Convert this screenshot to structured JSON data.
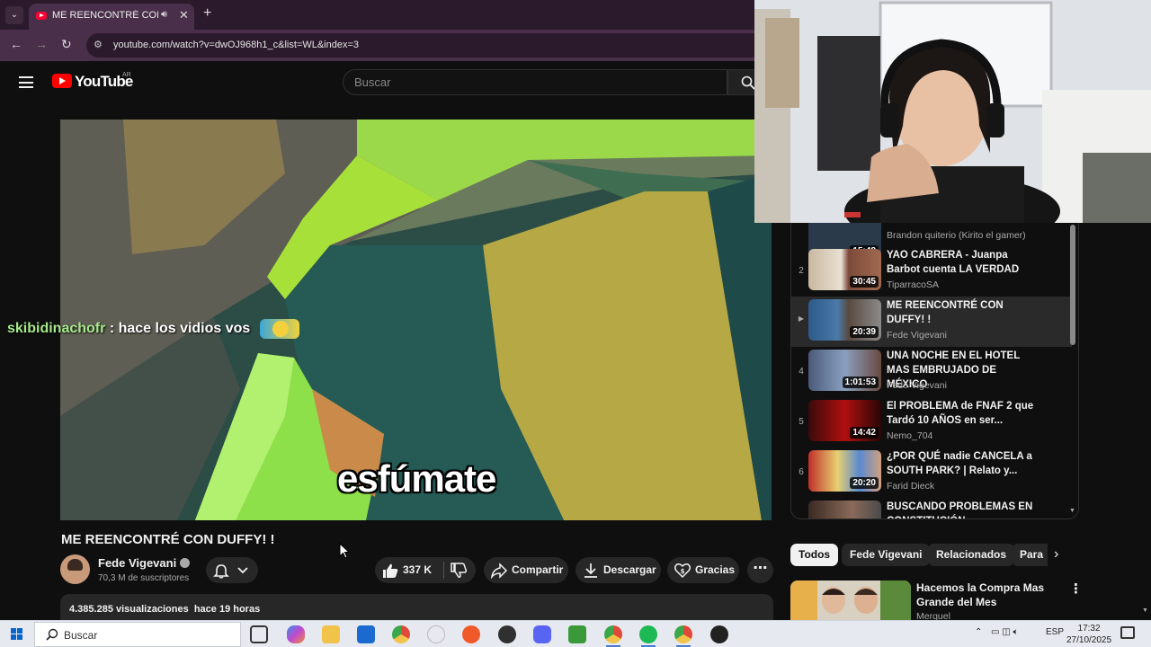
{
  "browser": {
    "tab_title": "ME REENCONTRÉ CON DUFFY! !",
    "url": "youtube.com/watch?v=dwOJ968h1_c&list=WL&index=3"
  },
  "youtube": {
    "logo_text": "YouTube",
    "country": "AR",
    "search_placeholder": "Buscar"
  },
  "video": {
    "subtitle": "esfúmate",
    "title": "ME REENCONTRÉ CON DUFFY! !",
    "channel": "Fede Vigevani",
    "subscribers": "70,3 M de suscriptores",
    "likes": "337 K",
    "share_label": "Compartir",
    "download_label": "Descargar",
    "thanks_label": "Gracias",
    "views": "4.385.285 visualizaciones",
    "time_ago": "hace 19 horas"
  },
  "chat": {
    "user": "skibidinachofr",
    "message": ": hace los vidios vos"
  },
  "playlist": [
    {
      "index": "",
      "duration": "15:48",
      "title": "",
      "channel": "Brandon quiterio (Kirito el gamer)"
    },
    {
      "index": "2",
      "duration": "30:45",
      "title": "YAO CABRERA - Juanpa Barbot cuenta LA VERDAD",
      "channel": "TiparracoSA"
    },
    {
      "index": "▶",
      "duration": "20:39",
      "title": "ME REENCONTRÉ CON DUFFY! !",
      "channel": "Fede Vigevani"
    },
    {
      "index": "4",
      "duration": "1:01:53",
      "title": "UNA NOCHE EN EL HOTEL MAS EMBRUJADO DE MÉXICO",
      "channel": "Fede Vigevani"
    },
    {
      "index": "5",
      "duration": "14:42",
      "title": "El PROBLEMA de FNAF 2 que Tardó 10 AÑOS en ser...",
      "channel": "Nemo_704"
    },
    {
      "index": "6",
      "duration": "20:20",
      "title": "¿POR QUÉ nadie CANCELA a SOUTH PARK? | Relato y...",
      "channel": "Farid Dieck"
    },
    {
      "index": "7",
      "duration": "",
      "title": "BUSCANDO PROBLEMAS EN CONSTITUCIÓN",
      "channel": ""
    }
  ],
  "chips": [
    "Todos",
    "Fede Vigevani",
    "Relacionados",
    "Para"
  ],
  "recommendation": {
    "title": "Hacemos la Compra Mas Grande del Mes",
    "channel": "Merquel"
  },
  "taskbar": {
    "search_placeholder": "Buscar",
    "language": "ESP",
    "time": "17:32",
    "date": "27/10/2025"
  },
  "colors": {
    "accent": "#ff0000",
    "background": "#0f0f0f",
    "chat_user": "#a6e88a"
  }
}
